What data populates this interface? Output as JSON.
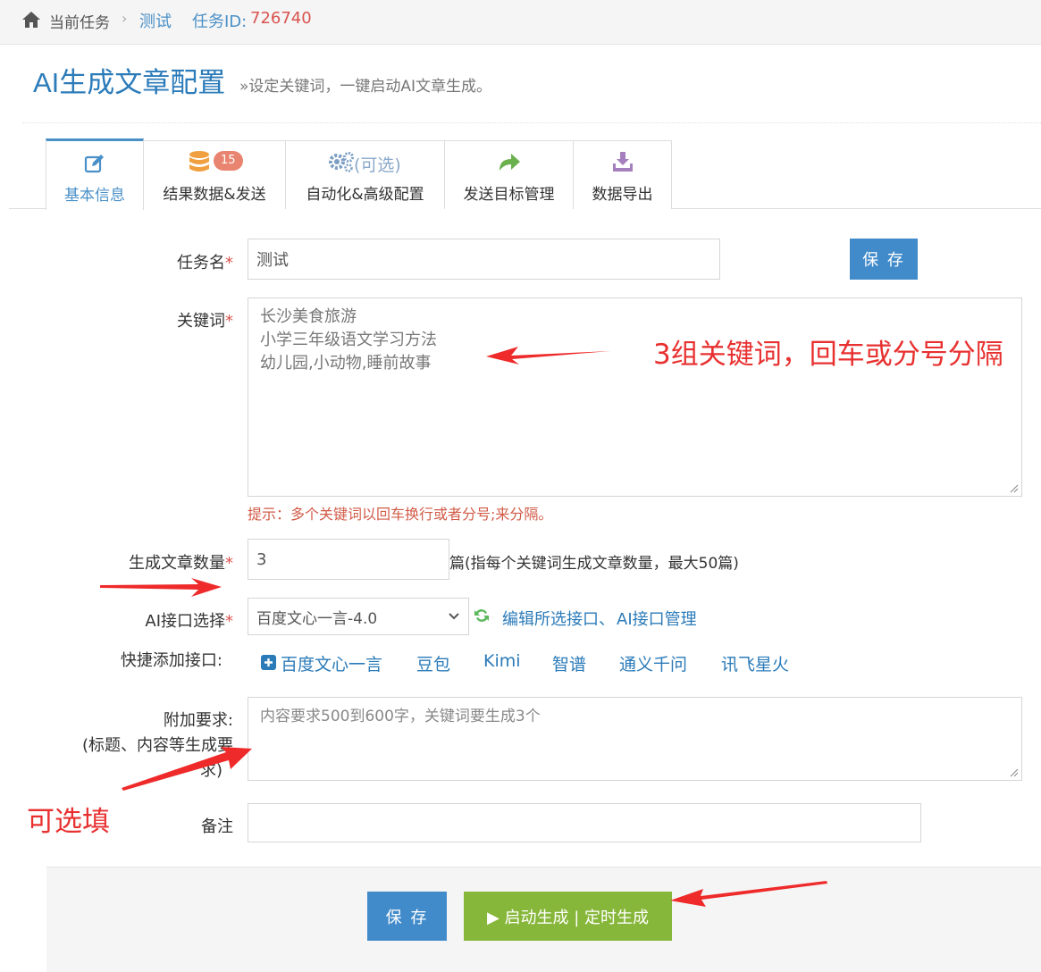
{
  "breadcrumb": {
    "current_label": "当前任务",
    "separator": "›",
    "task_name": "测试",
    "task_id_label": "任务ID:",
    "task_id_value": "726740"
  },
  "header": {
    "title": "AI生成文章配置",
    "subtitle": "»设定关键词，一键启动AI文章生成。"
  },
  "tabs": [
    {
      "label": "基本信息",
      "icon": "edit-icon",
      "active": true
    },
    {
      "label": "结果数据&发送",
      "icon": "database-icon",
      "badge": "15"
    },
    {
      "label": "自动化&高级配置",
      "icon": "gears-icon",
      "extra": "(可选)"
    },
    {
      "label": "发送目标管理",
      "icon": "share-arrow-icon"
    },
    {
      "label": "数据导出",
      "icon": "download-icon"
    }
  ],
  "form": {
    "required_mark": "*",
    "task_name": {
      "label": "任务名",
      "value": "测试"
    },
    "save_label": "保 存",
    "keywords": {
      "label": "关键词",
      "lines": [
        "长沙美食旅游",
        "小学三年级语文学习方法",
        "幼儿园,小动物,睡前故事"
      ],
      "hint": "提示：多个关键词以回车换行或者分号;来分隔。"
    },
    "article_count": {
      "label": "生成文章数量",
      "value": "3",
      "suffix": "篇(指每个关键词生成文章数量，最大50篇)"
    },
    "ai_interface": {
      "label": "AI接口选择",
      "selected": "百度文心一言-4.0",
      "edit_link": "编辑所选接口、",
      "manage_link": "AI接口管理"
    },
    "quick_add": {
      "label": "快捷添加接口:",
      "items": [
        "百度文心一言",
        "豆包",
        "Kimi",
        "智谱",
        "通义千问",
        "讯飞星火"
      ]
    },
    "extra_requirements": {
      "label_line1": "附加要求:",
      "label_line2": "(标题、内容等生成要",
      "label_line3": "求)",
      "placeholder": "内容要求500到600字，关键词要生成3个"
    },
    "remark": {
      "label": "备注",
      "value": ""
    }
  },
  "footer": {
    "save_label": "保 存",
    "start_label": "▶ 启动生成 | 定时生成"
  },
  "annotations": {
    "keywords_note": "3组关键词，回车或分号分隔",
    "optional_note": "可选填"
  },
  "colors": {
    "accent": "#428bca",
    "success": "#87b73a",
    "danger": "#d9534f",
    "annotation": "#e83030"
  }
}
